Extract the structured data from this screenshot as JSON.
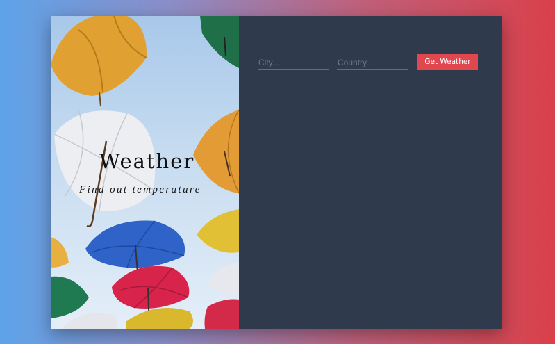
{
  "hero": {
    "title": "Weather",
    "subtitle": "Find out temperature"
  },
  "form": {
    "city_placeholder": "City...",
    "country_placeholder": "Country...",
    "submit_label": "Get Weather"
  },
  "colors": {
    "panel_background": "#2f3a4c",
    "button": "#e0474f",
    "gradient_left": "#5ea3e8",
    "gradient_right": "#d9404a"
  }
}
